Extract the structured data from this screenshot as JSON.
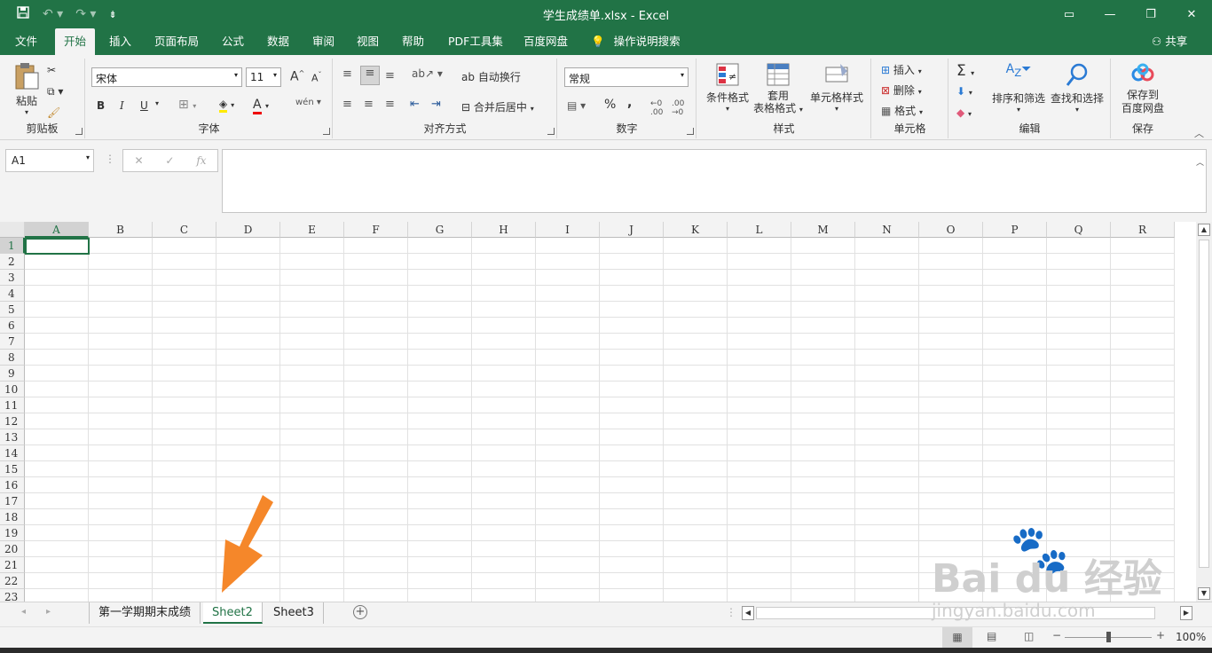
{
  "title": "学生成绩单.xlsx  -  Excel",
  "menu": {
    "file": "文件",
    "home": "开始",
    "insert": "插入",
    "page_layout": "页面布局",
    "formulas": "公式",
    "data": "数据",
    "review": "审阅",
    "view": "视图",
    "help": "帮助",
    "pdf": "PDF工具集",
    "baidu": "百度网盘",
    "tell_me": "操作说明搜索",
    "share": "共享"
  },
  "ribbon": {
    "clipboard": {
      "paste": "粘贴",
      "label": "剪贴板"
    },
    "font": {
      "name": "宋体",
      "size": "11",
      "bold": "B",
      "italic": "I",
      "underline": "U",
      "grow": "A",
      "shrink": "A",
      "label": "字体"
    },
    "alignment": {
      "wrap": "自动换行",
      "merge": "合并后居中",
      "label": "对齐方式"
    },
    "number": {
      "format": "常规",
      "percent": "%",
      "comma": ",",
      "label": "数字"
    },
    "styles": {
      "conditional": "条件格式",
      "table_1": "套用",
      "table_2": "表格格式",
      "cell_styles": "单元格样式",
      "label": "样式"
    },
    "cells": {
      "insert": "插入",
      "delete": "删除",
      "format": "格式",
      "label": "单元格"
    },
    "editing": {
      "sort": "排序和筛选",
      "find": "查找和选择",
      "label": "编辑"
    },
    "save": {
      "line1": "保存到",
      "line2": "百度网盘",
      "label": "保存"
    }
  },
  "formula_bar": {
    "name_box": "A1",
    "fx": "fx",
    "content": ""
  },
  "columns": [
    "A",
    "B",
    "C",
    "D",
    "E",
    "F",
    "G",
    "H",
    "I",
    "J",
    "K",
    "L",
    "M",
    "N",
    "O",
    "P",
    "Q",
    "R"
  ],
  "rows": [
    "1",
    "2",
    "3",
    "4",
    "5",
    "6",
    "7",
    "8",
    "9",
    "10",
    "11",
    "12",
    "13",
    "14",
    "15",
    "16",
    "17",
    "18",
    "19",
    "20",
    "21",
    "22",
    "23"
  ],
  "sheets": [
    "第一学期期末成绩",
    "Sheet2",
    "Sheet3"
  ],
  "active_sheet": "Sheet2",
  "status": {
    "zoom": "100%"
  },
  "colors": {
    "excel_green": "#217346",
    "arrow": "#f5872a"
  },
  "watermark": {
    "brand": "Bai du 经验",
    "url": "jingyan.baidu.com"
  }
}
